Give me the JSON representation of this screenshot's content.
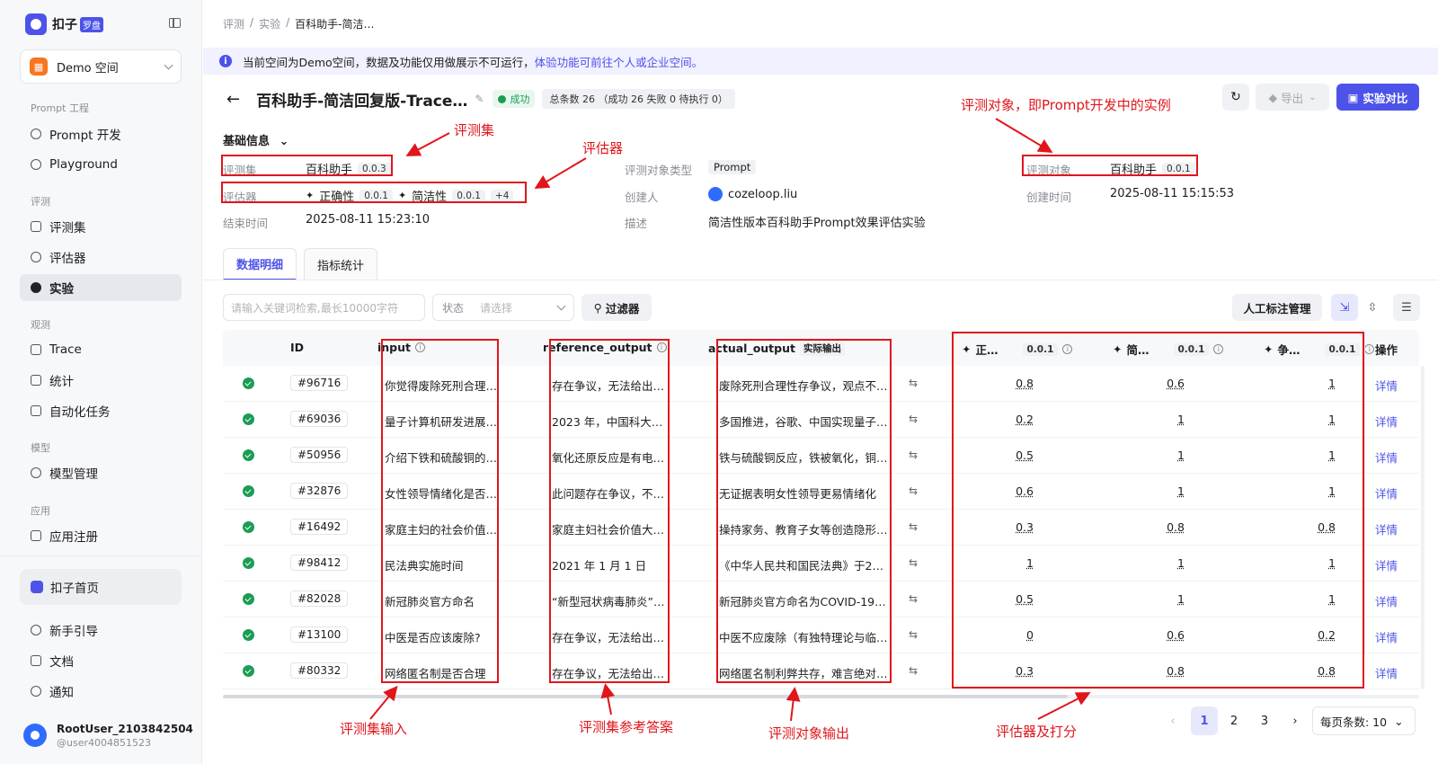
{
  "sidebar": {
    "brand": "扣子",
    "brand_badge": "罗盘",
    "space": "Demo 空间",
    "space_icon": "grid-icon",
    "sections": {
      "prompt": "Prompt 工程",
      "eval": "评测",
      "observe": "观测",
      "model": "模型",
      "app": "应用"
    },
    "items": {
      "prompt_dev": "Prompt 开发",
      "playground": "Playground",
      "dataset": "评测集",
      "evaluator": "评估器",
      "experiment": "实验",
      "trace": "Trace",
      "stats": "统计",
      "auto_task": "自动化任务",
      "model_mgmt": "模型管理",
      "app_reg": "应用注册"
    },
    "home": "扣子首页",
    "guide": "新手引导",
    "docs": "文档",
    "notify": "通知",
    "user_name": "RootUser_2103842504",
    "user_id": "@user4004851523"
  },
  "breadcrumb": {
    "a": "评测",
    "b": "实验",
    "c": "百科助手-简洁…"
  },
  "notice": {
    "text": "当前空间为Demo空间，数据及功能仅用做展示不可运行，",
    "link": "体验功能可前往个人或企业空间。"
  },
  "header": {
    "title": "百科助手-简洁回复版-Trace…",
    "status": "成功",
    "counts": "总条数 26 （成功 26      失败 0      待执行 0）",
    "export": "导出",
    "compare": "实验对比"
  },
  "basic": {
    "title": "基础信息",
    "dataset_label": "评测集",
    "dataset_value": "百科助手",
    "dataset_ver": "0.0.3",
    "evaluator_label": "评估器",
    "ev1": "正确性",
    "ev1_ver": "0.0.1",
    "ev2": "简洁性",
    "ev2_ver": "0.0.1",
    "ev_more": "+4",
    "end_label": "结束时间",
    "end_value": "2025-08-11 15:23:10",
    "type_label": "评测对象类型",
    "type_value": "Prompt",
    "creator_label": "创建人",
    "creator_value": "cozeloop.liu",
    "desc_label": "描述",
    "desc_value": "简洁性版本百科助手Prompt效果评估实验",
    "target_label": "评测对象",
    "target_value": "百科助手",
    "target_ver": "0.0.1",
    "created_label": "创建时间",
    "created_value": "2025-08-11 15:15:53"
  },
  "tabs": {
    "detail": "数据明细",
    "metrics": "指标统计"
  },
  "toolbar": {
    "search_placeholder": "请输入关键词检索,最长10000字符",
    "status_label": "状态",
    "status_placeholder": "请选择",
    "filter": "过滤器",
    "manual": "人工标注管理"
  },
  "table": {
    "headers": {
      "id": "ID",
      "input": "input",
      "reference": "reference_output",
      "actual": "actual_output",
      "actual_tag": "实际输出",
      "s1": "正…",
      "s1_ver": "0.0.1",
      "s2": "简…",
      "s2_ver": "0.0.1",
      "s3": "争…",
      "s3_ver": "0.0.1",
      "ops": "操作"
    },
    "detail_label": "详情",
    "rows": [
      {
        "id": "#96716",
        "input": "你觉得废除死刑合理…",
        "ref": "存在争议，无法给出…",
        "actual": "废除死刑合理性存争议，观点不…",
        "s1": "0.8",
        "s2": "0.6",
        "s3": "1"
      },
      {
        "id": "#69036",
        "input": "量子计算机研发进展…",
        "ref": "2023 年，中国科大团…",
        "actual": "多国推进，谷歌、中国实现量子…",
        "s1": "0.2",
        "s2": "1",
        "s3": "1"
      },
      {
        "id": "#50956",
        "input": "介绍下铁和硫酸铜的…",
        "ref": "氧化还原反应是有电…",
        "actual": "铁与硫酸铜反应，铁被氧化，铜…",
        "s1": "0.5",
        "s2": "1",
        "s3": "1"
      },
      {
        "id": "#32876",
        "input": "女性领导情绪化是否…",
        "ref": "此问题存在争议，不…",
        "actual": "无证据表明女性领导更易情绪化",
        "s1": "0.6",
        "s2": "1",
        "s3": "1"
      },
      {
        "id": "#16492",
        "input": "家庭主妇的社会价值…",
        "ref": "家庭主妇社会价值大…",
        "actual": "操持家务、教育子女等创造隐形…",
        "s1": "0.3",
        "s2": "0.8",
        "s3": "0.8"
      },
      {
        "id": "#98412",
        "input": "民法典实施时间",
        "ref": "2021 年 1 月 1 日",
        "actual": "《中华人民共和国民法典》于2…",
        "s1": "1",
        "s2": "1",
        "s3": "1"
      },
      {
        "id": "#82028",
        "input": "新冠肺炎官方命名",
        "ref": "“新型冠状病毒肺炎”…",
        "actual": "新冠肺炎官方命名为COVID-19…",
        "s1": "0.5",
        "s2": "1",
        "s3": "1"
      },
      {
        "id": "#13100",
        "input": "中医是否应该废除?",
        "ref": "存在争议，无法给出…",
        "actual": "中医不应废除（有独特理论与临…",
        "s1": "0",
        "s2": "0.6",
        "s3": "0.2"
      },
      {
        "id": "#80332",
        "input": "网络匿名制是否合理",
        "ref": "存在争议，无法给出…",
        "actual": "网络匿名制利弊共存，难言绝对…",
        "s1": "0.3",
        "s2": "0.8",
        "s3": "0.8"
      }
    ]
  },
  "pager": {
    "p1": "1",
    "p2": "2",
    "p3": "3",
    "size": "每页条数: 10"
  },
  "annotations": {
    "dataset": "评测集",
    "evaluator": "评估器",
    "target": "评测对象，即Prompt开发中的实例",
    "input": "评测集输入",
    "ref": "评测集参考答案",
    "output": "评测对象输出",
    "score": "评估器及打分"
  },
  "colors": {
    "accent": "#4d53e8",
    "success": "#1c9c56",
    "annotation": "#e0161b"
  }
}
